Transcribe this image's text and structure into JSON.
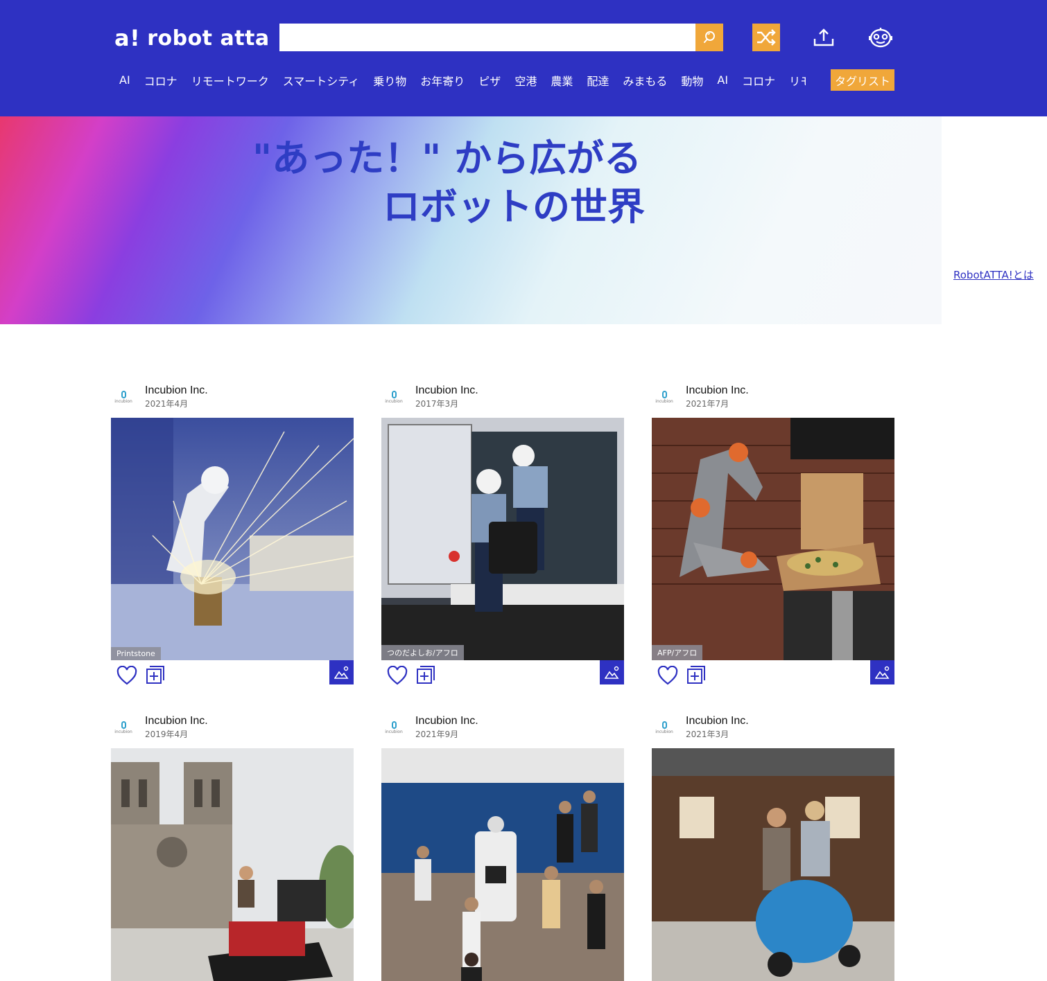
{
  "header": {
    "logo_mark": "a!",
    "logo_text": "robot atta",
    "search_placeholder": "",
    "tags": [
      "AI",
      "コロナ",
      "リモートワーク",
      "スマートシティ",
      "乗り物",
      "お年寄り",
      "ピザ",
      "空港",
      "農業",
      "配達",
      "みまもる",
      "動物",
      "AI",
      "コロナ",
      "リモ"
    ],
    "taglist_label": "タグリスト"
  },
  "hero": {
    "title_line1": "\"あった！\" から広がる",
    "title_line2": "ロボットの世界",
    "about_link": "RobotATTA!とは"
  },
  "cards": [
    {
      "author": "Incubion Inc.",
      "date": "2021年4月",
      "credit": "Printstone"
    },
    {
      "author": "Incubion Inc.",
      "date": "2017年3月",
      "credit": "つのだよしお/アフロ"
    },
    {
      "author": "Incubion Inc.",
      "date": "2021年7月",
      "credit": "AFP/アフロ"
    },
    {
      "author": "Incubion Inc.",
      "date": "2019年4月",
      "credit": ""
    },
    {
      "author": "Incubion Inc.",
      "date": "2021年9月",
      "credit": ""
    },
    {
      "author": "Incubion Inc.",
      "date": "2021年3月",
      "credit": ""
    }
  ],
  "avatar_brand": "incubion",
  "colors": {
    "brand": "#2e31c2",
    "accent": "#f0a73a"
  }
}
